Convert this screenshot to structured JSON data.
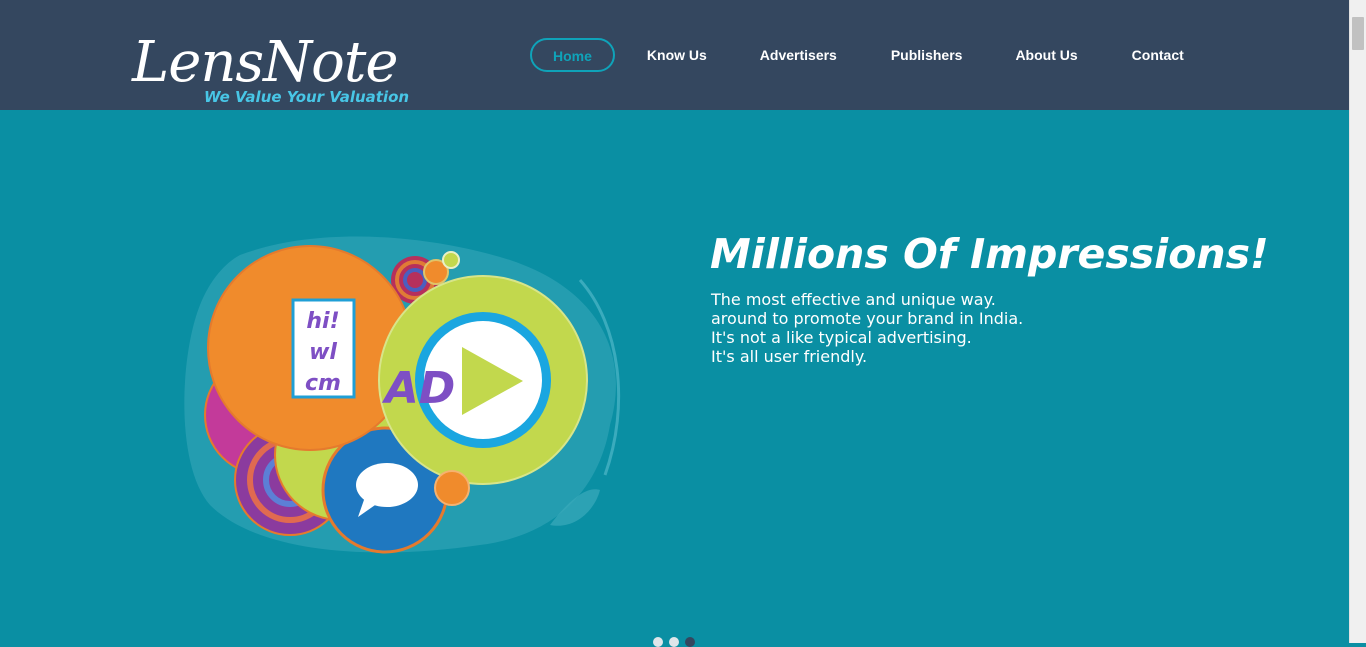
{
  "logo": {
    "name": "LensNote",
    "tagline": "We Value Your Valuation"
  },
  "nav": {
    "items": [
      {
        "label": "Home",
        "active": true
      },
      {
        "label": "Know Us"
      },
      {
        "label": "Advertisers"
      },
      {
        "label": "Publishers"
      },
      {
        "label": "About Us"
      },
      {
        "label": "Contact"
      }
    ]
  },
  "hero": {
    "title": "Millions Of Impressions!",
    "lines": [
      "The most effective and unique way.",
      "around to promote your brand in India.",
      "It's not a like typical advertising.",
      "It's all user friendly."
    ],
    "illustration": {
      "card_lines": [
        "hi!",
        "wl",
        "cm"
      ],
      "ad_text": "AD",
      "icons": [
        "play-icon",
        "chat-bubble-icon"
      ]
    }
  },
  "slider": {
    "dots": 3,
    "active_index": 2
  },
  "colors": {
    "header_bg": "#34475f",
    "hero_bg": "#0a8fa3",
    "accent": "#0fa3b9",
    "tagline": "#48c6e6",
    "orange": "#f08b2c",
    "lime": "#c2d84d",
    "blue": "#1f78c0",
    "magenta": "#c33a9a",
    "purple": "#7e4fc4"
  }
}
